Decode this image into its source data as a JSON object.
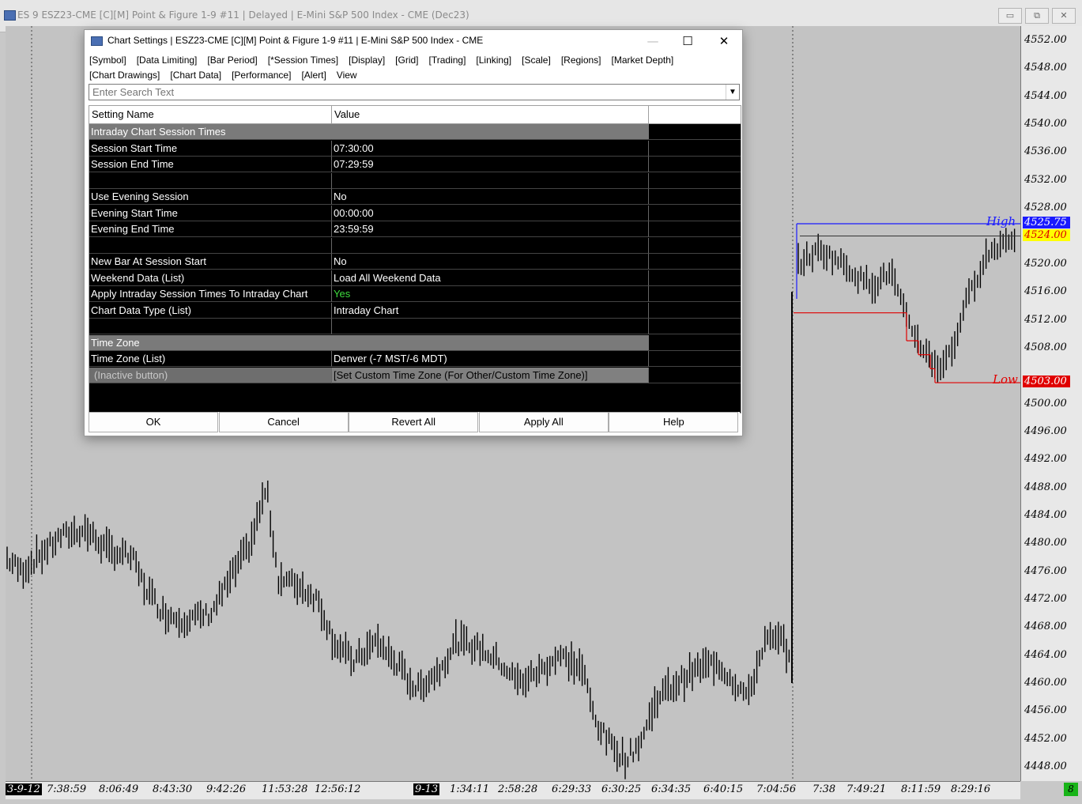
{
  "window": {
    "title": "ES 9 ESZ23-CME [C][M]  Point & Figure 1-9 #11 | Delayed | E-Mini S&P 500 Index - CME (Dec23)",
    "minimize": "▭",
    "restore": "⧉",
    "close": "✕"
  },
  "dialog": {
    "title": "Chart Settings | ESZ23-CME [C][M]  Point & Figure 1-9 #11 | E-Mini S&P 500 Index - CME",
    "minimize": "—",
    "maximize": "☐",
    "close": "✕",
    "tabs_row1": [
      "[Symbol]",
      "[Data Limiting]",
      "[Bar Period]",
      "[*Session Times]",
      "[Display]",
      "[Grid]",
      "[Trading]",
      "[Linking]",
      "[Scale]",
      "[Regions]",
      "[Market Depth]"
    ],
    "tabs_row2": [
      "[Chart Drawings]",
      "[Chart Data]",
      "[Performance]",
      "[Alert]",
      "View"
    ],
    "search_placeholder": "Enter Search Text",
    "columns": [
      "Setting Name",
      "Value",
      ""
    ],
    "rows": [
      {
        "type": "section",
        "name": "Intraday Chart Session Times",
        "value": ""
      },
      {
        "type": "row",
        "name": "Session Start Time",
        "value": "07:30:00"
      },
      {
        "type": "row",
        "name": "Session End Time",
        "value": "07:29:59"
      },
      {
        "type": "blank",
        "name": "",
        "value": ""
      },
      {
        "type": "row",
        "name": "Use Evening Session",
        "value": "No"
      },
      {
        "type": "row",
        "name": "Evening Start Time",
        "value": "00:00:00"
      },
      {
        "type": "row",
        "name": "Evening End Time",
        "value": "23:59:59"
      },
      {
        "type": "blank",
        "name": "",
        "value": ""
      },
      {
        "type": "row",
        "name": "New Bar At Session Start",
        "value": "No"
      },
      {
        "type": "row",
        "name": "Weekend Data (List)",
        "value": "Load All Weekend Data"
      },
      {
        "type": "row",
        "name": "Apply Intraday Session Times To Intraday Chart",
        "value": "Yes",
        "value_color": "#3ddc3d"
      },
      {
        "type": "row",
        "name": "Chart Data Type (List)",
        "value": "Intraday Chart"
      },
      {
        "type": "blank",
        "name": "",
        "value": ""
      },
      {
        "type": "section",
        "name": "Time Zone",
        "value": ""
      },
      {
        "type": "row",
        "name": "Time Zone (List)",
        "value": "Denver (-7 MST/-6 MDT)"
      },
      {
        "type": "inactive",
        "name": "(Inactive button)",
        "value": "[Set Custom Time Zone (For Other/Custom Time Zone)]"
      }
    ],
    "buttons": [
      "OK",
      "Cancel",
      "Revert All",
      "Apply All",
      "Help"
    ]
  },
  "price_axis": {
    "labels": [
      "4552.00",
      "4548.00",
      "4544.00",
      "4540.00",
      "4536.00",
      "4532.00",
      "4528.00",
      "4520.00",
      "4516.00",
      "4512.00",
      "4508.00",
      "4500.00",
      "4496.00",
      "4492.00",
      "4488.00",
      "4484.00",
      "4480.00",
      "4476.00",
      "4472.00",
      "4468.00",
      "4464.00",
      "4460.00",
      "4456.00",
      "4452.00",
      "4448.00"
    ],
    "high_tag": "4525.75",
    "current_tag": "4524.00",
    "low_tag": "4503.00"
  },
  "chart": {
    "high_label": "High",
    "low_label": "Low",
    "colors": {
      "high": "#1a1aff",
      "low": "#e00000",
      "bars": "#000000",
      "current": "#ffff00"
    }
  },
  "time_axis": {
    "labels": [
      "3-9-12",
      "7:38:59",
      "8:06:49",
      "8:43:30",
      "9:42:26",
      "11:53:28",
      "12:56:12",
      "9-13",
      "1:34:11",
      "2:58:28",
      "6:29:33",
      "6:30:25",
      "6:34:35",
      "6:40:15",
      "7:04:56",
      "7:38",
      "7:49:21",
      "8:11:59",
      "8:29:16"
    ],
    "corner": "8"
  }
}
